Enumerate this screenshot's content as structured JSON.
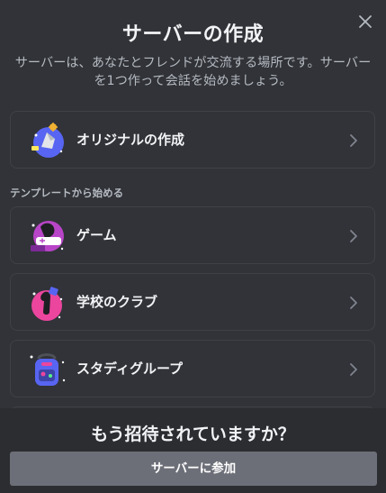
{
  "modal": {
    "title": "サーバーの作成",
    "subtitle": "サーバーは、あなたとフレンドが交流する場所です。サーバーを1つ作って会話を始めましょう。"
  },
  "create_own": {
    "label": "オリジナルの作成",
    "icon": "create-own-server-icon"
  },
  "templates": {
    "section_label": "テンプレートから始める",
    "items": [
      {
        "label": "ゲーム",
        "icon": "gaming-template-icon"
      },
      {
        "label": "学校のクラブ",
        "icon": "school-club-template-icon"
      },
      {
        "label": "スタディグループ",
        "icon": "study-group-template-icon"
      }
    ]
  },
  "footer": {
    "title": "もう招待されていますか？",
    "join_label": "サーバーに参加"
  },
  "colors": {
    "background": "#313338",
    "footer_bg": "#2b2d31",
    "card_border": "#3f4147",
    "button_bg": "#6d6f78",
    "text_primary": "#f2f3f5",
    "text_secondary": "#b5bac1"
  }
}
